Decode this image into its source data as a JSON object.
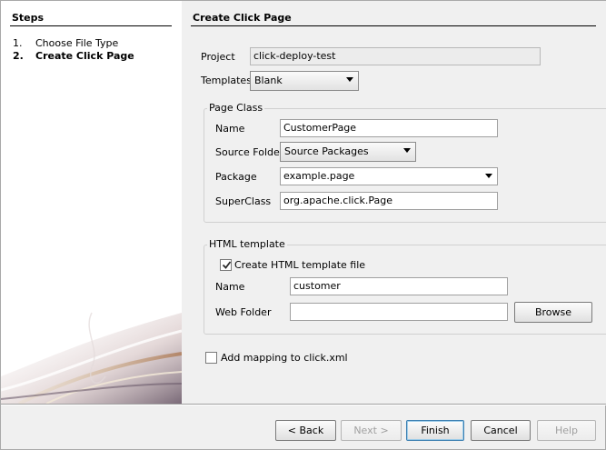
{
  "steps": {
    "title": "Steps",
    "items": [
      {
        "num": "1.",
        "label": "Choose File Type"
      },
      {
        "num": "2.",
        "label": "Create Click Page"
      }
    ]
  },
  "main": {
    "title": "Create Click Page",
    "project": {
      "label": "Project",
      "value": "click-deploy-test"
    },
    "templates": {
      "label": "Templates",
      "value": "Blank"
    },
    "page_class": {
      "title": "Page Class",
      "name": {
        "label": "Name",
        "value": "CustomerPage"
      },
      "source_folder": {
        "label": "Source Folder",
        "value": "Source Packages"
      },
      "package": {
        "label": "Package",
        "value": "example.page"
      },
      "superclass": {
        "label": "SuperClass",
        "value": "org.apache.click.Page"
      }
    },
    "html_template": {
      "title": "HTML template",
      "create_checkbox": {
        "label": "Create HTML template file",
        "checked": true
      },
      "name": {
        "label": "Name",
        "value": "customer"
      },
      "web_folder": {
        "label": "Web Folder",
        "value": ""
      },
      "browse_label": "Browse"
    },
    "mapping_checkbox": {
      "label": "Add mapping to click.xml",
      "checked": false
    }
  },
  "buttons": {
    "back": "< Back",
    "next": "Next >",
    "finish": "Finish",
    "cancel": "Cancel",
    "help": "Help"
  },
  "colors": {
    "default_button_border": "#3c7fb1",
    "panel_bg": "#f0f0f0"
  }
}
